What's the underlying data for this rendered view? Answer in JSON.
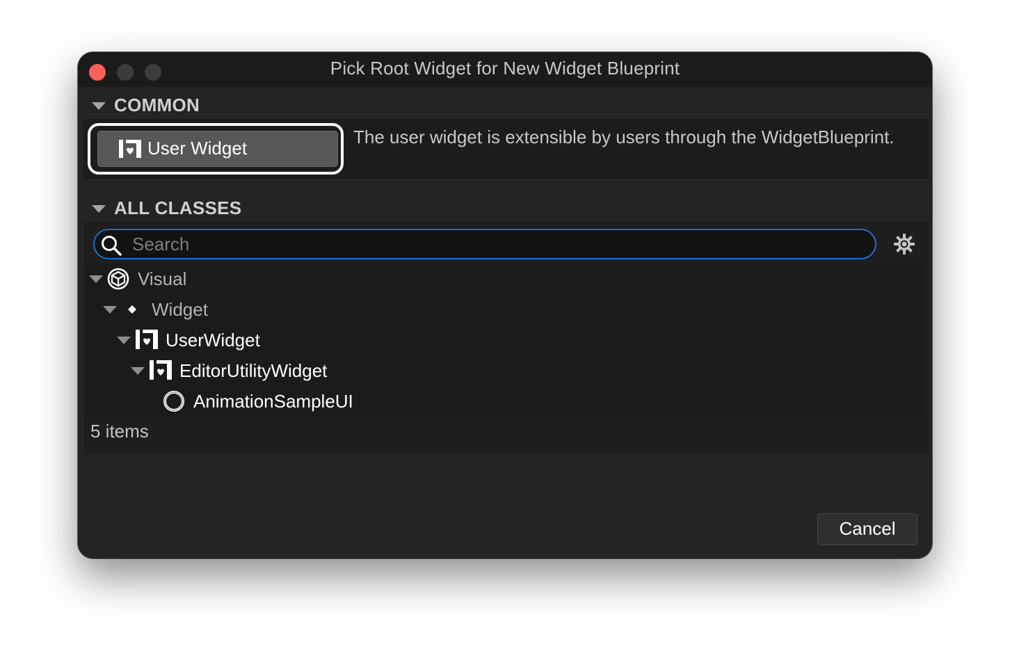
{
  "window": {
    "title": "Pick Root Widget for New Widget Blueprint"
  },
  "common": {
    "header": "COMMON",
    "button_label": "User Widget",
    "button_icon": "user-widget-icon",
    "description": "The user widget is extensible by users through the WidgetBlueprint."
  },
  "all_classes": {
    "header": "ALL CLASSES",
    "search": {
      "placeholder": "Search",
      "value": ""
    },
    "tree": [
      {
        "label": "Visual",
        "icon": "visual-cube-icon",
        "expanded": true,
        "depth": 0
      },
      {
        "label": "Widget",
        "icon": "diamond-icon",
        "expanded": true,
        "depth": 1
      },
      {
        "label": "UserWidget",
        "icon": "user-widget-icon",
        "expanded": true,
        "depth": 2
      },
      {
        "label": "EditorUtilityWidget",
        "icon": "user-widget-icon",
        "expanded": true,
        "depth": 3
      },
      {
        "label": "AnimationSampleUI",
        "icon": "blueprint-ring-icon",
        "expanded": false,
        "depth": 4
      }
    ],
    "status": "5 items"
  },
  "footer": {
    "cancel_label": "Cancel"
  },
  "colors": {
    "accent": "#1d6fd3",
    "close": "#fe5f57",
    "background": "#242424"
  }
}
